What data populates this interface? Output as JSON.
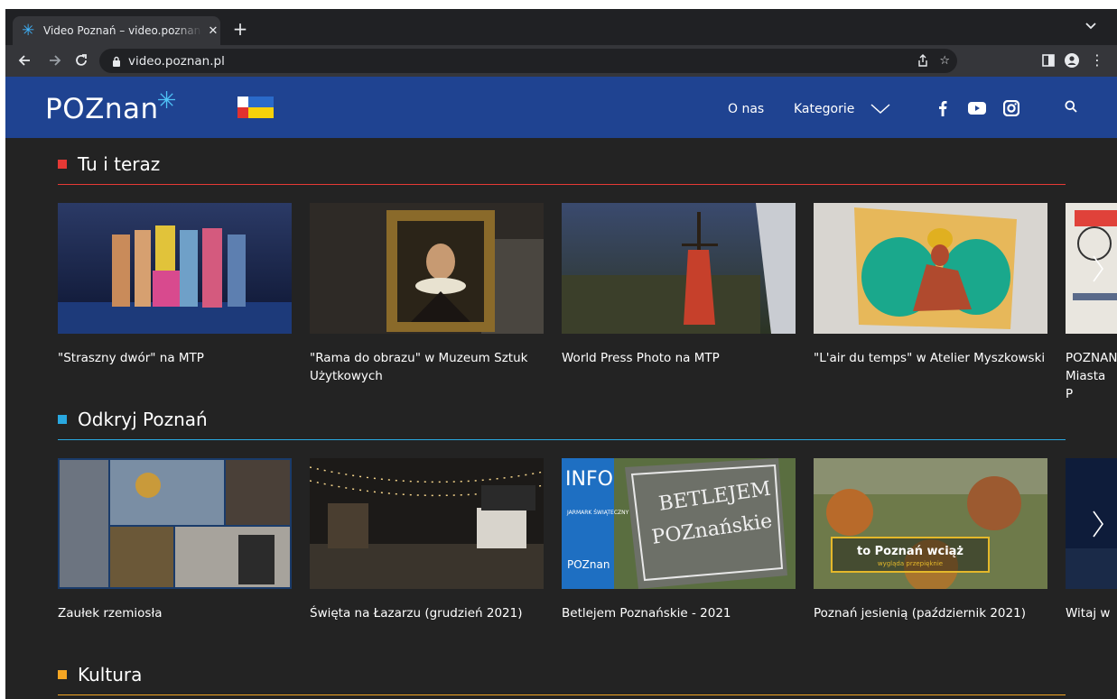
{
  "browser": {
    "tab_title": "Video Poznań – video.poznan.pl",
    "url": "video.poznan.pl"
  },
  "site": {
    "logo_text": "POZnan",
    "logo_star": "*",
    "nav": {
      "about": "O nas",
      "categories": "Kategorie"
    },
    "accent_colors": {
      "header": "#1f4391",
      "tu_i_teraz": "#e53935",
      "odkryj": "#29a8e0",
      "kultura": "#f5a623"
    }
  },
  "sections": [
    {
      "title": "Tu i teraz",
      "items": [
        "\"Straszny dwór\" na MTP",
        "\"Rama do obrazu\" w Muzeum Sztuk Użytkowych",
        "World Press Photo na MTP",
        "\"L'air du temps\" w Atelier Myszkowski",
        "POZNAN Miasta P"
      ]
    },
    {
      "title": "Odkryj Poznań",
      "items": [
        "Zaułek rzemiosła",
        "Święta na Łazarzu (grudzień 2021)",
        "Betlejem Poznańskie - 2021",
        "Poznań jesienią (październik 2021)",
        "Witaj w"
      ],
      "overlay_texts": {
        "info": "INFO",
        "jarmark": "JARMARK ŚWIĄTECZNY W CENTRUM I NA ŁAZARZU",
        "poznan_small": "POZnan",
        "betlejem_sign_1": "BETLEJEM",
        "betlejem_sign_2": "POZnańskie",
        "jesien_1": "to Poznań wciąż",
        "jesien_2": "wygląda przepięknie"
      }
    },
    {
      "title": "Kultura"
    }
  ]
}
